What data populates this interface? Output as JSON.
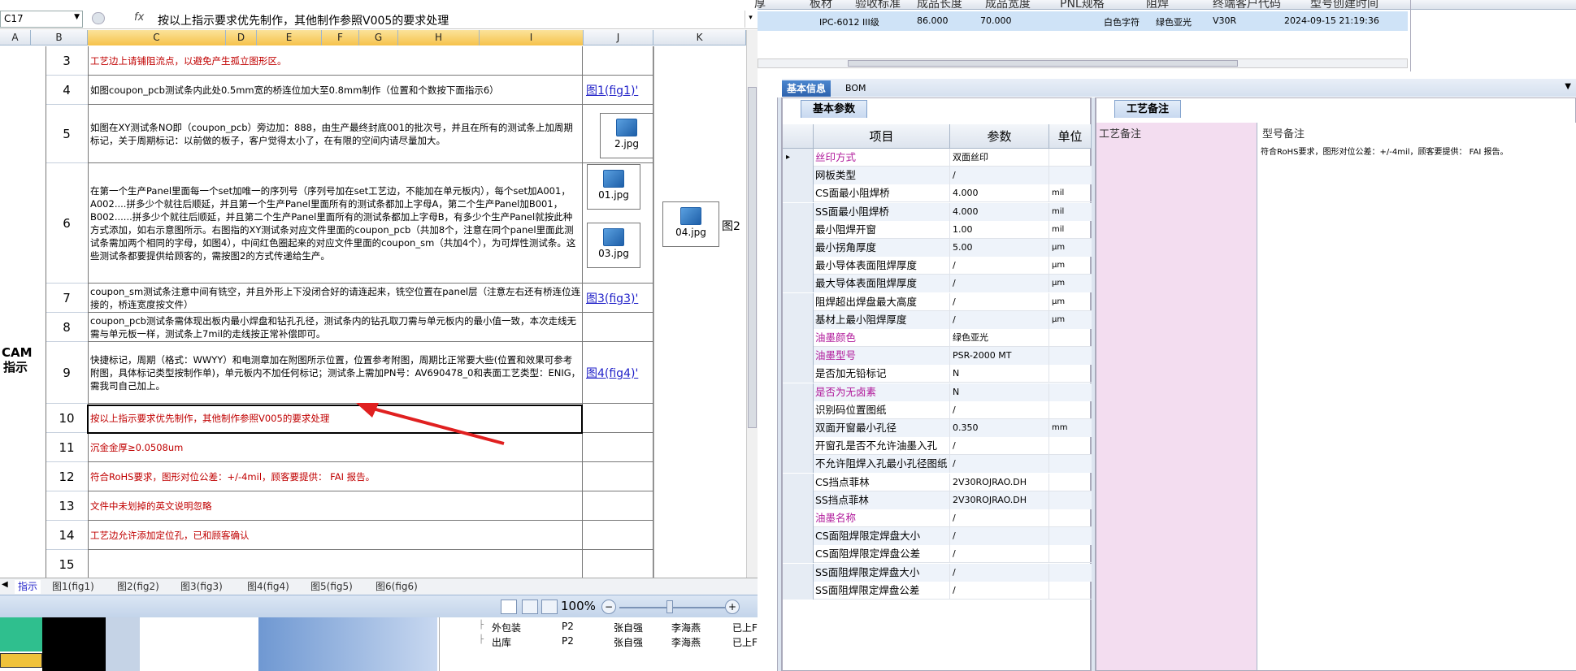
{
  "excel": {
    "name_box": "C17",
    "fx_label": "fx",
    "formula": "按以上指示要求优先制作，其他制作参照V005的要求处理",
    "columns": [
      "A",
      "B",
      "C",
      "D",
      "E",
      "F",
      "G",
      "H",
      "I",
      "J",
      "K"
    ],
    "cam_label": "CAM指示",
    "rows": [
      {
        "num": "3",
        "text": "工艺边上请铺阻流点，以避免产生孤立图形区。",
        "red": true,
        "link": ""
      },
      {
        "num": "4",
        "text": "如图coupon_pcb测试条内此处0.5mm宽的桥连位加大至0.8mm制作（位置和个数按下面指示6）",
        "red": false,
        "link": "图1(fig1)'"
      },
      {
        "num": "5",
        "text": "如图在XY测试条NO即（coupon_pcb）旁边加：888，由生产最终封底001的批次号，并且在所有的测试条上加周期标记，关于周期标记：以前做的板子，客户觉得太小了，在有限的空间内请尽量加大。",
        "red": false,
        "link": ""
      },
      {
        "num": "6",
        "text": "在第一个生产Panel里面每一个set加唯一的序列号（序列号加在set工艺边，不能加在单元板内），每个set加A001，A002....拼多少个就往后顺延，并且第一个生产Panel里面所有的测试条都加上字母A，第二个生产Panel加B001，B002......拼多少个就往后顺延，并且第二个生产Panel里面所有的测试条都加上字母B，有多少个生产Panel就按此种方式添加，如右示意图所示。右图指的XY测试条对应文件里面的coupon_pcb（共加8个，注意在同个panel里面此测试条需加两个相同的字母，如图4），中间红色圈起来的对应文件里面的coupon_sm（共加4个），为可焊性测试条。这些测试条都要提供给顾客的，需按图2的方式传递给生产。",
        "red": false,
        "link": ""
      },
      {
        "num": "7",
        "text": "coupon_sm测试条注意中间有铣空，并且外形上下没闭合好的请连起来，铣空位置在panel层（注意左右还有桥连位连接的，桥连宽度按文件）",
        "red": false,
        "link": "图3(fig3)'"
      },
      {
        "num": "8",
        "text": "coupon_pcb测试条需体现出板内最小焊盘和钻孔孔径，测试条内的钻孔取刀需与单元板内的最小值一致，本次走线无需与单元板一样，测试条上7mil的走线按正常补偿即可。",
        "red": false,
        "link": ""
      },
      {
        "num": "9",
        "text": "快捷标记，周期（格式：WWYY）和电测章加在附图所示位置，位置参考附图，周期比正常要大些(位置和效果可参考附图，具体标记类型按制作单)，单元板内不加任何标记；测试条上需加PN号：AV690478_0和表面工艺类型：ENIG，需我司自己加上。",
        "red": false,
        "link": "图4(fig4)'"
      },
      {
        "num": "10",
        "text": "按以上指示要求优先制作，其他制作参照V005的要求处理",
        "red": true,
        "link": ""
      },
      {
        "num": "11",
        "text": "沉金金厚≥0.0508um",
        "red": true,
        "link": ""
      },
      {
        "num": "12",
        "text": "符合RoHS要求，图形对位公差：+/-4mil，顾客要提供： FAI 报告。",
        "red": true,
        "link": ""
      },
      {
        "num": "13",
        "text": "文件中未划掉的英文说明忽略",
        "red": true,
        "link": ""
      },
      {
        "num": "14",
        "text": "工艺边允许添加定位孔，已和顾客确认",
        "red": true,
        "link": ""
      },
      {
        "num": "15",
        "text": "",
        "red": false,
        "link": ""
      }
    ],
    "files": {
      "f2": "2.jpg",
      "f01": "01.jpg",
      "f03": "03.jpg",
      "f04": "04.jpg"
    },
    "k_label": "图2",
    "sheet_tabs": [
      "指示",
      "图1(fig1)",
      "图2(fig2)",
      "图3(fig3)",
      "图4(fig4)",
      "图5(fig5)",
      "图6(fig6)"
    ],
    "zoom": "100%"
  },
  "lower_left": {
    "rows": [
      {
        "name": "外包装",
        "code": "P2",
        "person": "张自强",
        "reviewer": "李海燕",
        "state": "已上F"
      },
      {
        "name": "出库",
        "code": "P2",
        "person": "张自强",
        "reviewer": "李海燕",
        "state": "已上F"
      }
    ]
  },
  "top_grid": {
    "headers": [
      "厚",
      "板材",
      "验收标准",
      "成品长度",
      "成品宽度",
      "PNL规格",
      "阻焊",
      "终端客户代码",
      "型号创建时间"
    ],
    "row": {
      "name": "IPC-6012 III级",
      "length": "86.000",
      "width": "70.000",
      "mask": "白色字符",
      "color": "绿色亚光",
      "cust": "V30R",
      "time": "2024-09-15 21:19:36"
    }
  },
  "tabs": {
    "basic": "基本信息",
    "bom": "BOM"
  },
  "params_panel": {
    "tab": "基本参数",
    "headers": {
      "item": "项目",
      "param": "参数",
      "unit": "单位"
    },
    "rows": [
      {
        "item": "丝印方式",
        "param": "双面丝印",
        "unit": "",
        "pink": true
      },
      {
        "item": "网板类型",
        "param": "/",
        "unit": "",
        "pink": false
      },
      {
        "item": "CS面最小阻焊桥",
        "param": "4.000",
        "unit": "mil",
        "pink": false
      },
      {
        "item": "SS面最小阻焊桥",
        "param": "4.000",
        "unit": "mil",
        "pink": false
      },
      {
        "item": "最小阻焊开窗",
        "param": "1.00",
        "unit": "mil",
        "pink": false
      },
      {
        "item": "最小拐角厚度",
        "param": "5.00",
        "unit": "μm",
        "pink": false
      },
      {
        "item": "最小导体表面阻焊厚度",
        "param": "/",
        "unit": "μm",
        "pink": false
      },
      {
        "item": "最大导体表面阻焊厚度",
        "param": "/",
        "unit": "μm",
        "pink": false
      },
      {
        "item": "阻焊超出焊盘最大高度",
        "param": "/",
        "unit": "μm",
        "pink": false
      },
      {
        "item": "基材上最小阻焊厚度",
        "param": "/",
        "unit": "μm",
        "pink": false
      },
      {
        "item": "油墨颜色",
        "param": "绿色亚光",
        "unit": "",
        "pink": true
      },
      {
        "item": "油墨型号",
        "param": "PSR-2000 MT",
        "unit": "",
        "pink": true
      },
      {
        "item": "是否加无铅标记",
        "param": "N",
        "unit": "",
        "pink": false
      },
      {
        "item": "是否为无卤素",
        "param": "N",
        "unit": "",
        "pink": true
      },
      {
        "item": "识别码位置图纸",
        "param": "/",
        "unit": "",
        "pink": false
      },
      {
        "item": "双面开窗最小孔径",
        "param": "0.350",
        "unit": "mm",
        "pink": false
      },
      {
        "item": "开窗孔是否不允许油墨入孔",
        "param": "/",
        "unit": "",
        "pink": false
      },
      {
        "item": "不允许阻焊入孔最小孔径图纸",
        "param": "/",
        "unit": "",
        "pink": false
      },
      {
        "item": "CS挡点菲林",
        "param": "2V30ROJRAO.DH",
        "unit": "",
        "pink": false
      },
      {
        "item": "SS挡点菲林",
        "param": "2V30ROJRAO.DH",
        "unit": "",
        "pink": false
      },
      {
        "item": "油墨名称",
        "param": "/",
        "unit": "",
        "pink": true
      },
      {
        "item": "CS面阻焊限定焊盘大小",
        "param": "/",
        "unit": "",
        "pink": false
      },
      {
        "item": "CS面阻焊限定焊盘公差",
        "param": "/",
        "unit": "",
        "pink": false
      },
      {
        "item": "SS面阻焊限定焊盘大小",
        "param": "/",
        "unit": "",
        "pink": false
      },
      {
        "item": "SS面阻焊限定焊盘公差",
        "param": "/",
        "unit": "",
        "pink": false
      }
    ]
  },
  "notes_panel": {
    "tab": "工艺备注",
    "col1": "工艺备注",
    "col2": "型号备注",
    "model_note": "符合RoHS要求，图形对位公差：+/-4mil，顾客要提供： FAI 报告。"
  },
  "colors": {
    "accent": "#2d62ad",
    "note_bg": "#f3ddf0",
    "red_text": "#c00000",
    "pink_text": "#b0189a"
  }
}
